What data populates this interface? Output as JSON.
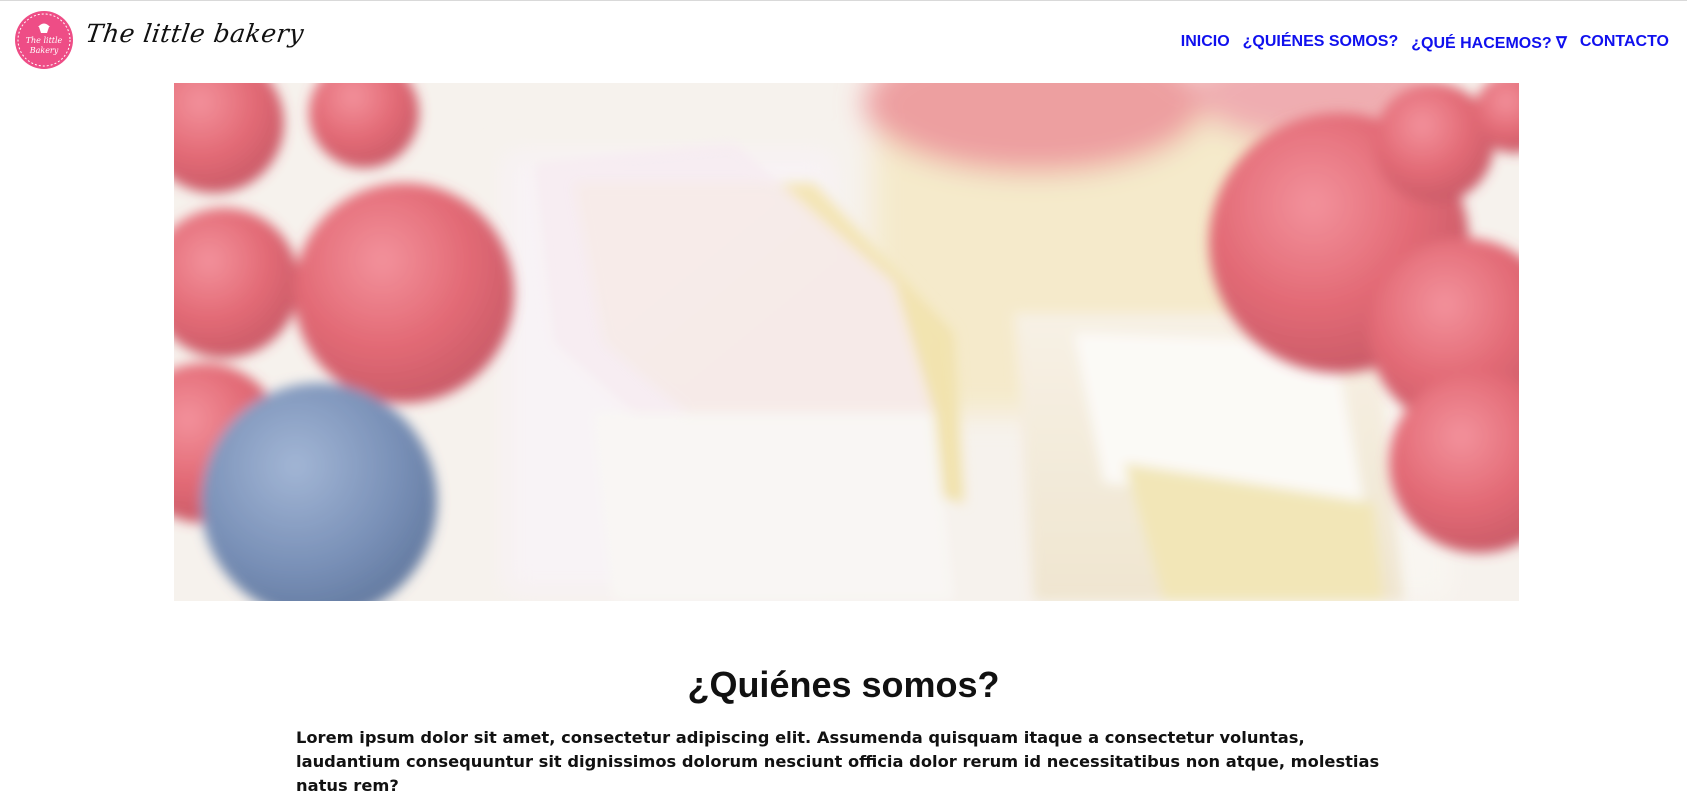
{
  "header": {
    "logo_text": [
      "The little",
      "Bakery"
    ],
    "brand_name": "The little bakery"
  },
  "nav": {
    "items": [
      {
        "label": "INICIO"
      },
      {
        "label": "¿QUIÉNES SOMOS?"
      },
      {
        "label": "¿QUÉ HACEMOS? ∇"
      },
      {
        "label": "CONTACTO"
      }
    ]
  },
  "hero": {
    "description": "blurred photo of cupcakes with raspberries, strawberries and blueberry"
  },
  "about": {
    "title": "¿Quiénes somos?",
    "text": "Lorem ipsum dolor sit amet, consectetur adipiscing elit. Assumenda quisquam itaque a consectetur voluntas, laudantium consequuntur sit dignissimos dolorum nesciunt officia dolor rerum id necessitatibus non atque, molestias natus rem?"
  },
  "colors": {
    "nav_link": "#1010ee",
    "logo_pink": "#ee4d86"
  }
}
